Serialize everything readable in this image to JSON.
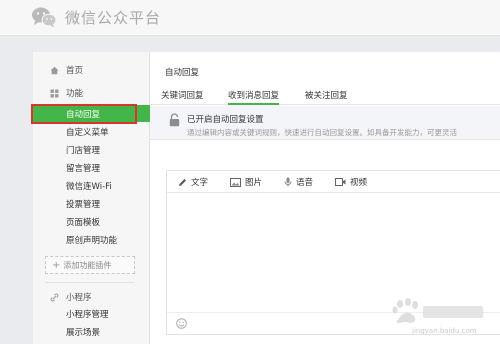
{
  "header": {
    "title": "微信公众平台",
    "logo_icon": "wechat-logo-icon"
  },
  "sidebar": {
    "home": {
      "label": "首页",
      "icon": "home-icon"
    },
    "feature_group": {
      "label": "功能",
      "icon": "grid-icon"
    },
    "items": [
      {
        "label": "自动回复",
        "active": true
      },
      {
        "label": "自定义菜单",
        "active": false
      },
      {
        "label": "门店管理",
        "active": false
      },
      {
        "label": "留言管理",
        "active": false
      },
      {
        "label": "微信连Wi-Fi",
        "active": false
      },
      {
        "label": "投票管理",
        "active": false
      },
      {
        "label": "页面模板",
        "active": false
      },
      {
        "label": "原创声明功能",
        "active": false
      }
    ],
    "add_plugin": "添加功能插件",
    "miniprogram_group": {
      "label": "小程序",
      "icon": "link-icon"
    },
    "miniprogram_items": [
      {
        "label": "小程序管理"
      },
      {
        "label": "展示场景"
      }
    ]
  },
  "main": {
    "title": "自动回复",
    "tabs": [
      {
        "label": "关键词回复",
        "active": false
      },
      {
        "label": "收到消息回复",
        "active": true
      },
      {
        "label": "被关注回复",
        "active": false
      }
    ],
    "notice": {
      "title": "已开启自动回复设置",
      "description": "通过编辑内容或关键词规则，快速进行自动回复设置。如具备开发能力，可更灵活"
    },
    "editor": {
      "tools": [
        {
          "label": "文字",
          "icon": "pen-icon"
        },
        {
          "label": "图片",
          "icon": "image-icon"
        },
        {
          "label": "语音",
          "icon": "microphone-icon"
        },
        {
          "label": "视频",
          "icon": "video-icon"
        }
      ],
      "emoji_icon": "emoji-icon"
    }
  },
  "watermark": {
    "text": "jingyan.baidu.com"
  },
  "colors": {
    "accent": "#44b549",
    "highlight_box": "#d9362b",
    "sidebar_bg": "#f6f6f6",
    "page_bg": "#e9ebee"
  }
}
